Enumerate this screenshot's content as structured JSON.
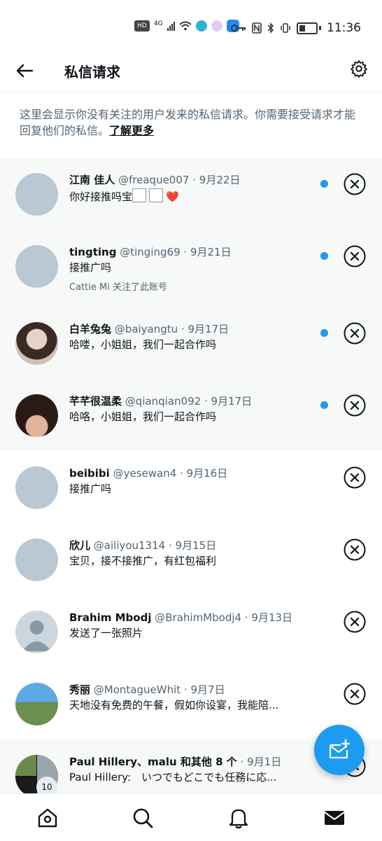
{
  "status_bar": {
    "hd": "HD",
    "network": "4G",
    "time": "11:36"
  },
  "header": {
    "title": "私信请求",
    "back_icon": "back-arrow-icon",
    "settings_icon": "gear-icon"
  },
  "notice": {
    "text": "这里会显示你没有关注的用户发来的私信请求。你需要接受请求才能回复他们的私信。",
    "link": "了解更多"
  },
  "colors": {
    "accent": "#1d9bf0",
    "unread_bg": "#f7f9f9",
    "secondary_text": "#536471"
  },
  "requests": [
    {
      "name": "江南 佳人",
      "handle": "@freaque007",
      "sep": "·",
      "date": "9月22日",
      "message": "你好接推吗宝",
      "emoji": "❤️",
      "unread": true
    },
    {
      "name": "tingting",
      "handle": "@tinging69",
      "sep": "·",
      "date": "9月21日",
      "message": "接推广吗",
      "note": "Cattie Mi 关注了此账号",
      "unread": true
    },
    {
      "name": "白羊兔兔",
      "handle": "@baiyangtu",
      "sep": "·",
      "date": "9月17日",
      "message": "哈喽，小姐姐，我们一起合作吗",
      "unread": true
    },
    {
      "name": "芊芊很温柔",
      "handle": "@qianqian092",
      "sep": "·",
      "date": "9月17日",
      "message": "哈咯，小姐姐，我们一起合作吗",
      "unread": true
    },
    {
      "name": "beibibi",
      "handle": "@yesewan4",
      "sep": "·",
      "date": "9月16日",
      "message": "接推广吗",
      "unread": false
    },
    {
      "name": "欣儿",
      "handle": "@ailiyou1314",
      "sep": "·",
      "date": "9月15日",
      "message": "宝贝，接不接推广，有红包福利",
      "unread": false
    },
    {
      "name": "Brahim Mbodj",
      "handle": "@BrahimMbodj4",
      "sep": "·",
      "date": "9月13日",
      "message": "发送了一张照片",
      "unread": false
    },
    {
      "name": "秀丽",
      "handle": "@MontagueWhit",
      "sep": "·",
      "date": "9月7日",
      "message": "天地没有免费的午餐，假如你设宴，我能陪...",
      "unread": false
    },
    {
      "name": "Paul Hillery、malu 和其他 8 个",
      "handle": "",
      "sep": "·",
      "date": "9月1日",
      "message": "Paul Hillery:　いつでもどこでも任務に応...",
      "badge": "10",
      "unread": true
    }
  ],
  "bottom_nav": [
    "home-icon",
    "search-icon",
    "notifications-bell-icon",
    "messages-envelope-icon"
  ],
  "fab": {
    "icon": "new-message-icon"
  }
}
